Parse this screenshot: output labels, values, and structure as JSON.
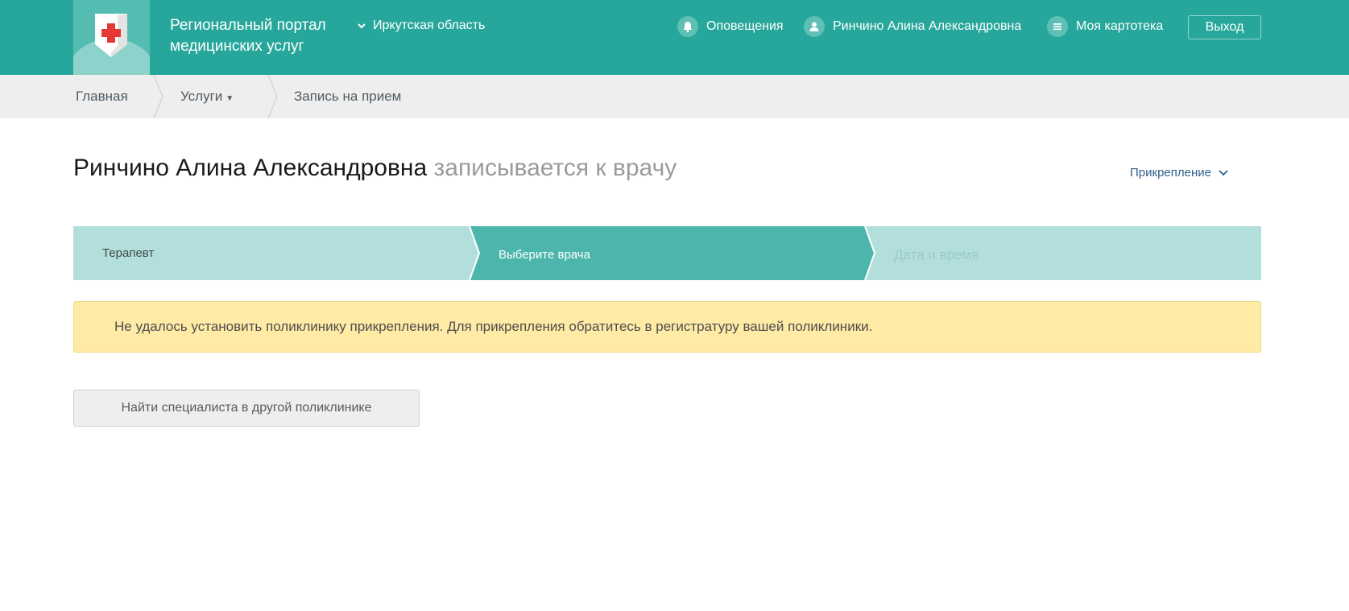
{
  "header": {
    "portal_title": "Региональный портал медицинских услуг",
    "region": "Иркутская область",
    "notifications": "Оповещения",
    "user_name": "Ринчино Алина Александровна",
    "my_record": "Моя картотека",
    "logout": "Выход",
    "colors": {
      "bar": "#27a79b",
      "logo_cross": "#e53935"
    }
  },
  "breadcrumb": {
    "items": [
      {
        "label": "Главная"
      },
      {
        "label": "Услуги",
        "caret": "▼"
      },
      {
        "label": "Запись на прием"
      }
    ]
  },
  "page": {
    "patient_name": "Ринчино Алина Александровна",
    "title_suffix": "записывается к врачу",
    "attach_label": "Прикрепление"
  },
  "steps": [
    {
      "label": "Терапевт",
      "state": "done"
    },
    {
      "label": "Выберите врача",
      "state": "active"
    },
    {
      "label": "Дата и время",
      "state": "pending"
    }
  ],
  "alert": {
    "text": "Не удалось установить поликлинику прикрепления. Для прикрепления обратитесь в регистратуру вашей поликлиники."
  },
  "actions": {
    "find_other": "Найти специалиста в другой поликлинике"
  }
}
